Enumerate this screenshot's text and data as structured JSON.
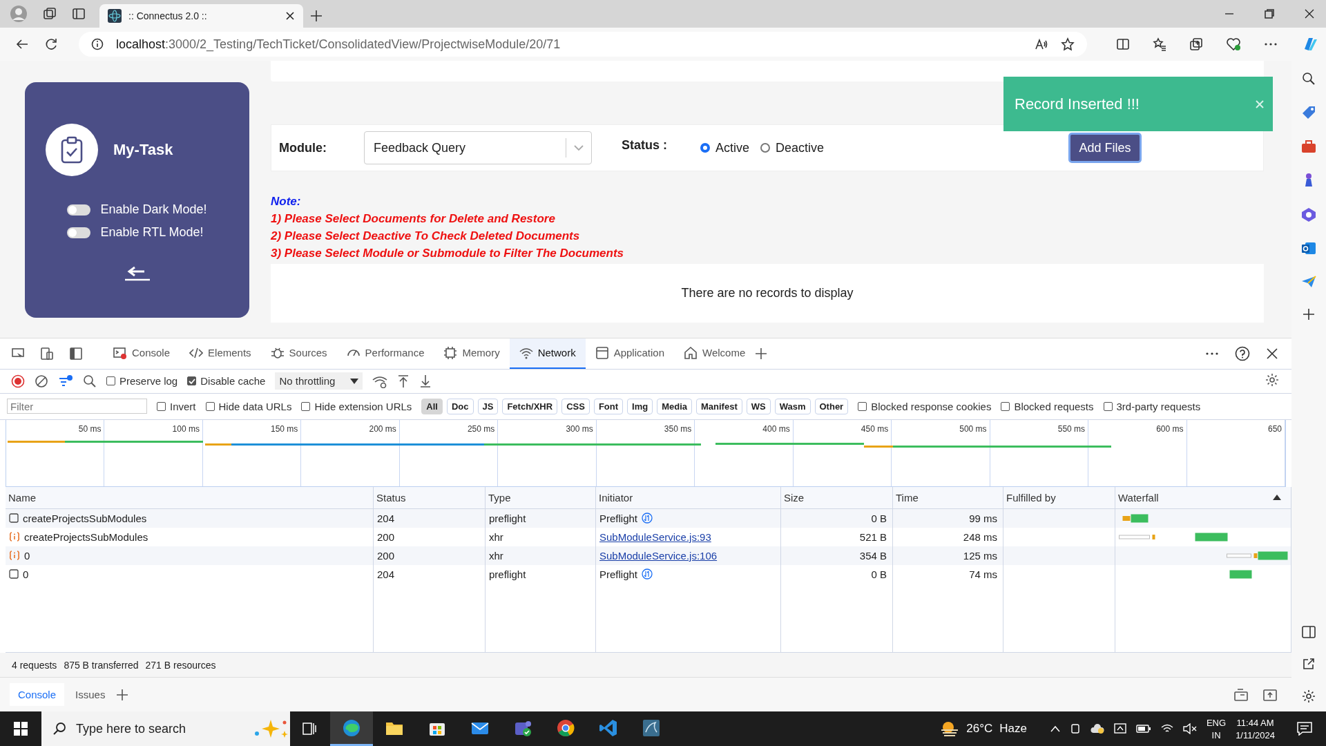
{
  "browser": {
    "tab": {
      "title": ":: Connectus 2.0 ::"
    },
    "address": {
      "host": "localhost",
      "path": ":3000/2_Testing/TechTicket/ConsolidatedView/ProjectwiseModule/20/71"
    }
  },
  "task_card": {
    "title": "My-Task",
    "toggles": [
      {
        "label": "Enable Dark Mode!",
        "on": false
      },
      {
        "label": "Enable RTL Mode!",
        "on": false
      }
    ]
  },
  "filters": {
    "module_label": "Module:",
    "module_value": "Feedback Query",
    "status_label": "Status :",
    "status_options": [
      {
        "label": "Active",
        "selected": true
      },
      {
        "label": "Deactive",
        "selected": false
      }
    ],
    "button": "Add Files"
  },
  "toast": {
    "message": "Record Inserted !!!"
  },
  "note": {
    "heading": "Note:",
    "lines": [
      "1) Please Select Documents for Delete and Restore",
      "2) Please Select Deactive To Check Deleted Documents",
      "3) Please Select Module or Submodule to Filter The Documents"
    ]
  },
  "empty_message": "There are no records to display",
  "devtools": {
    "tabs": [
      {
        "label": "Console",
        "selected": false
      },
      {
        "label": "Elements",
        "selected": false
      },
      {
        "label": "Sources",
        "selected": false
      },
      {
        "label": "Performance",
        "selected": false
      },
      {
        "label": "Memory",
        "selected": false
      },
      {
        "label": "Network",
        "selected": true
      },
      {
        "label": "Application",
        "selected": false
      },
      {
        "label": "Welcome",
        "selected": false
      }
    ],
    "toolbar_checks": [
      {
        "label": "Preserve log",
        "checked": false
      },
      {
        "label": "Disable cache",
        "checked": true
      }
    ],
    "throttling": "No throttling",
    "filter": {
      "placeholder": "Filter"
    },
    "filter_checks": [
      {
        "label": "Invert",
        "checked": false
      },
      {
        "label": "Hide data URLs",
        "checked": false
      },
      {
        "label": "Hide extension URLs",
        "checked": false
      }
    ],
    "type_filters": [
      {
        "label": "All",
        "selected": true
      },
      {
        "label": "Doc",
        "selected": false
      },
      {
        "label": "JS",
        "selected": false
      },
      {
        "label": "Fetch/XHR",
        "selected": false
      },
      {
        "label": "CSS",
        "selected": false
      },
      {
        "label": "Font",
        "selected": false
      },
      {
        "label": "Img",
        "selected": false
      },
      {
        "label": "Media",
        "selected": false
      },
      {
        "label": "Manifest",
        "selected": false
      },
      {
        "label": "WS",
        "selected": false
      },
      {
        "label": "Wasm",
        "selected": false
      },
      {
        "label": "Other",
        "selected": false
      }
    ],
    "more_checks": [
      {
        "label": "Blocked response cookies",
        "checked": false
      },
      {
        "label": "Blocked requests",
        "checked": false
      },
      {
        "label": "3rd-party requests",
        "checked": false
      }
    ],
    "timeline_ticks": [
      "50 ms",
      "100 ms",
      "150 ms",
      "200 ms",
      "250 ms",
      "300 ms",
      "350 ms",
      "400 ms",
      "450 ms",
      "500 ms",
      "550 ms",
      "600 ms",
      "650"
    ],
    "columns": [
      "Name",
      "Status",
      "Type",
      "Initiator",
      "Size",
      "Time",
      "Fulfilled by",
      "Waterfall"
    ],
    "rows": [
      {
        "kind": "preflight",
        "name": "createProjectsSubModules",
        "status": "204",
        "type": "preflight",
        "initiator": "Preflight",
        "initiator_link": false,
        "size": "0 B",
        "time": "99 ms"
      },
      {
        "kind": "xhr",
        "name": "createProjectsSubModules",
        "status": "200",
        "type": "xhr",
        "initiator": "SubModuleService.js:93",
        "initiator_link": true,
        "size": "521 B",
        "time": "248 ms"
      },
      {
        "kind": "xhr",
        "name": "0",
        "status": "200",
        "type": "xhr",
        "initiator": "SubModuleService.js:106",
        "initiator_link": true,
        "size": "354 B",
        "time": "125 ms"
      },
      {
        "kind": "preflight",
        "name": "0",
        "status": "204",
        "type": "preflight",
        "initiator": "Preflight",
        "initiator_link": false,
        "size": "0 B",
        "time": "74 ms"
      }
    ],
    "summary": [
      "4 requests",
      "875 B transferred",
      "271 B resources"
    ],
    "drawer_tabs": [
      {
        "label": "Console",
        "selected": true
      },
      {
        "label": "Issues",
        "selected": false
      }
    ]
  },
  "taskbar": {
    "search_placeholder": "Type here to search",
    "apps": [
      {
        "kind": "edge",
        "selected": true
      },
      {
        "kind": "folder",
        "selected": false
      },
      {
        "kind": "store",
        "selected": false
      },
      {
        "kind": "mail",
        "selected": false
      },
      {
        "kind": "teams",
        "selected": false
      },
      {
        "kind": "chrome",
        "selected": false
      },
      {
        "kind": "vscode",
        "selected": false
      },
      {
        "kind": "database",
        "selected": false
      }
    ],
    "weather": {
      "temp": "26°C",
      "condition": "Haze"
    },
    "language": [
      "ENG",
      "IN"
    ],
    "time": "11:44 AM",
    "date": "1/11/2024"
  }
}
